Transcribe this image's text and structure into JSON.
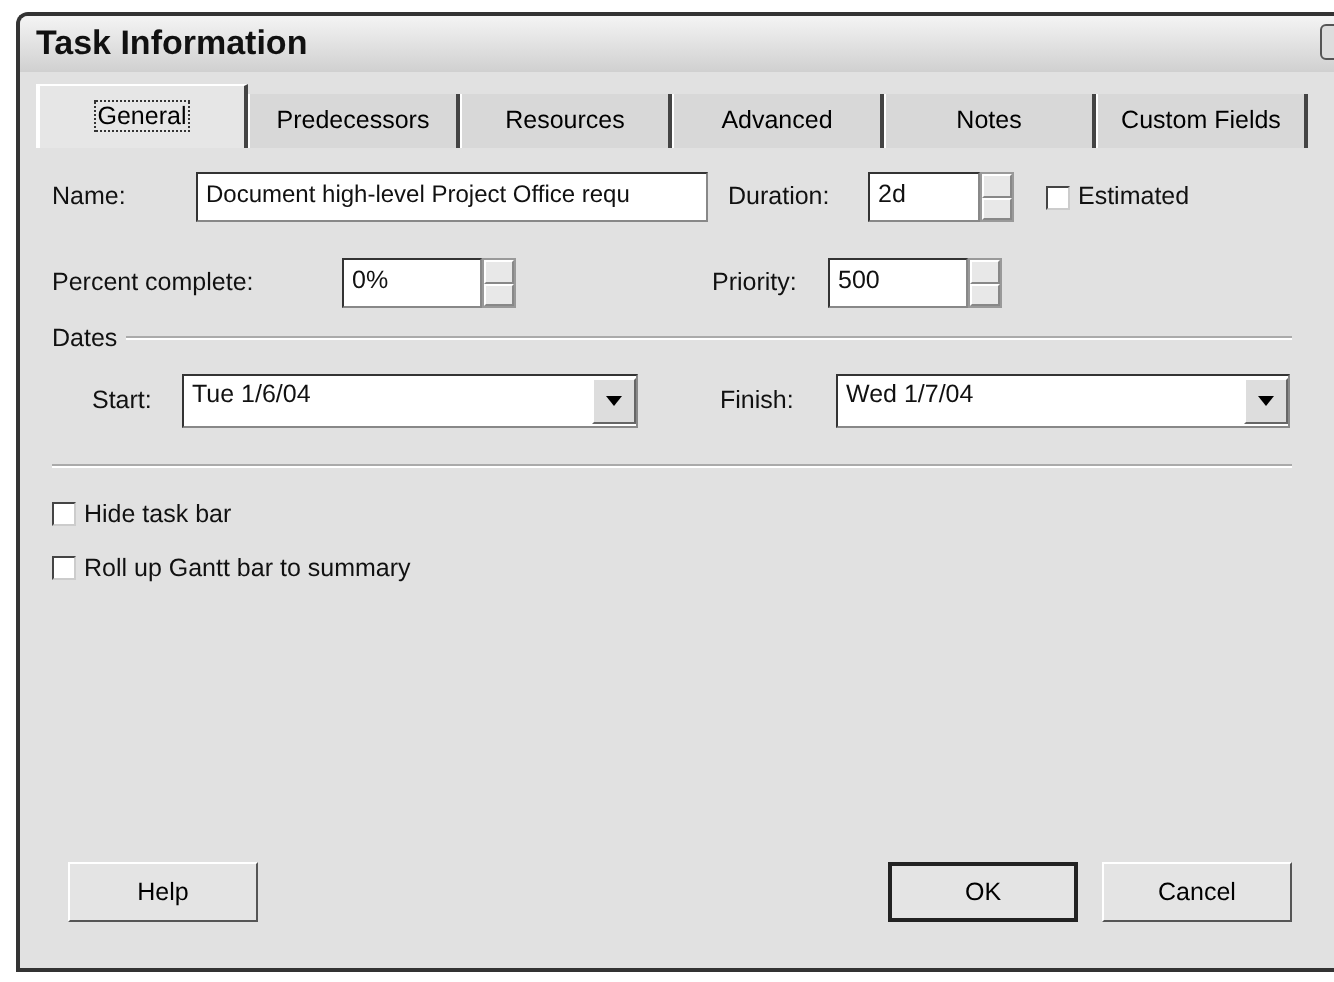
{
  "window": {
    "title": "Task Information"
  },
  "tabs": [
    {
      "label": "General",
      "selected": true
    },
    {
      "label": "Predecessors",
      "selected": false
    },
    {
      "label": "Resources",
      "selected": false
    },
    {
      "label": "Advanced",
      "selected": false
    },
    {
      "label": "Notes",
      "selected": false
    },
    {
      "label": "Custom Fields",
      "selected": false
    }
  ],
  "name": {
    "label": "Name:",
    "value": "Document high-level Project Office requ"
  },
  "duration": {
    "label": "Duration:",
    "value": "2d"
  },
  "estimated": {
    "label": "Estimated",
    "checked": false
  },
  "percent_complete": {
    "label": "Percent complete:",
    "value": "0%"
  },
  "priority": {
    "label": "Priority:",
    "value": "500"
  },
  "dates": {
    "title": "Dates",
    "start": {
      "label": "Start:",
      "value": "Tue 1/6/04"
    },
    "finish": {
      "label": "Finish:",
      "value": "Wed 1/7/04"
    }
  },
  "options": [
    {
      "label": "Hide task bar",
      "checked": false
    },
    {
      "label": "Roll up Gantt bar to summary",
      "checked": false
    }
  ],
  "buttons": [
    {
      "label": "Help",
      "default": false
    },
    {
      "label": "OK",
      "default": true
    },
    {
      "label": "Cancel",
      "default": false
    }
  ]
}
